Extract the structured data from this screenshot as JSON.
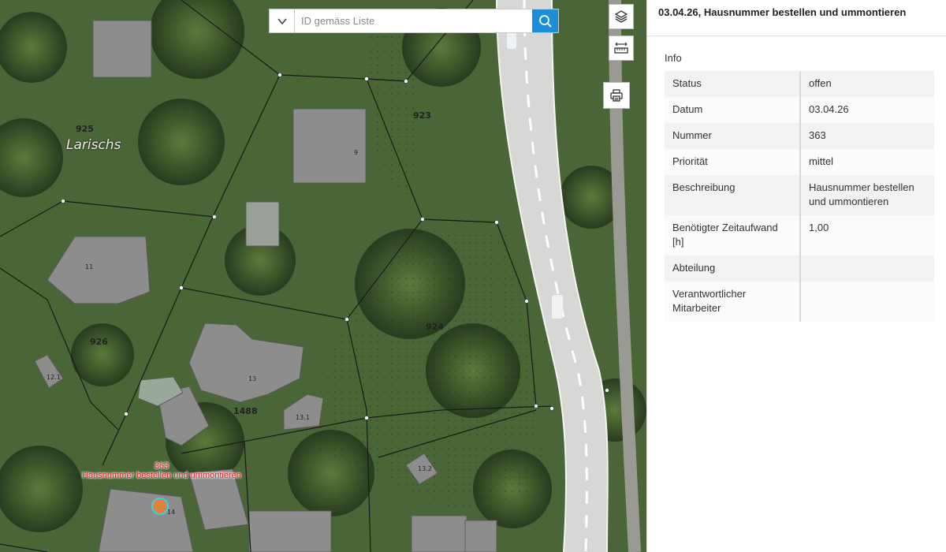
{
  "map": {
    "place_name": "Larischs",
    "parcels": [
      "925",
      "923",
      "924",
      "926",
      "1488"
    ],
    "house_numbers": [
      "9",
      "11",
      "13",
      "13.1",
      "13.2",
      "12.1",
      "14"
    ],
    "marker": {
      "id": "363",
      "text": "Hausnummer bestellen und ummontieren"
    }
  },
  "search": {
    "placeholder": "ID gemäss Liste"
  },
  "toolbar": {
    "layers_icon": "layers-icon",
    "measure_icon": "ruler-icon",
    "print_icon": "printer-icon"
  },
  "panel": {
    "title": "03.04.26, Hausnummer bestellen und ummontieren",
    "section_label": "Info",
    "rows": [
      {
        "key": "Status",
        "value": "offen"
      },
      {
        "key": "Datum",
        "value": "03.04.26"
      },
      {
        "key": "Nummer",
        "value": "363"
      },
      {
        "key": "Priorität",
        "value": "mittel"
      },
      {
        "key": "Beschreibung",
        "value": "Hausnummer bestellen und ummontieren"
      },
      {
        "key": "Benötigter Zeitaufwand [h]",
        "value": "1,00"
      },
      {
        "key": "Abteilung",
        "value": ""
      },
      {
        "key": "Verantwortlicher Mitarbeiter",
        "value": ""
      }
    ]
  },
  "colors": {
    "accent": "#1a8fd8",
    "marker_label": "#e02020",
    "marker_ring": "#2fd6e8"
  }
}
